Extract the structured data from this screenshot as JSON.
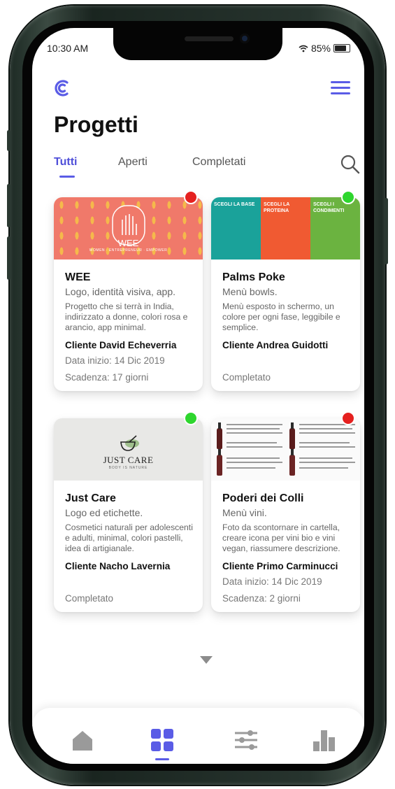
{
  "status_bar": {
    "time": "10:30 AM",
    "battery": "85%"
  },
  "header": {
    "title": "Progetti"
  },
  "tabs": [
    {
      "label": "Tutti",
      "active": true
    },
    {
      "label": "Aperti",
      "active": false
    },
    {
      "label": "Completati",
      "active": false
    }
  ],
  "projects": [
    {
      "name": "WEE",
      "subtitle": "Logo, identità visiva, app.",
      "description": "Progetto che si terrà in India, indirizzato a donne, colori rosa e arancio, app minimal.",
      "client": "Cliente David Echeverria",
      "start": "Data inizio: 14 Dic 2019",
      "deadline": "Scadenza: 17 giorni",
      "status_color": "#e5201f",
      "image_text": "WEE",
      "image_sub": "WOMEN · ENTREPRENEUR · EMPOWER"
    },
    {
      "name": "Palms Poke",
      "subtitle": "Menù bowls.",
      "description": "Menù esposto in schermo, un colore per ogni fase, leggibile e semplice.",
      "client": "Cliente Andrea Guidotti",
      "status_text": "Completato",
      "status_color": "#2ed62e",
      "image_cols": [
        "SCEGLI LA BASE",
        "SCEGLI LA PROTEINA",
        "SCEGLI I CONDIMENTI"
      ]
    },
    {
      "name": "Just Care",
      "subtitle": "Logo ed etichette.",
      "description": "Cosmetici naturali per adolescenti e adulti, minimal, colori pastelli, idea di artigianale.",
      "client": "Cliente Nacho Lavernia",
      "status_text": "Completato",
      "status_color": "#2ed62e",
      "image_text": "JUST CARE",
      "image_sub": "BODY IS NATURE"
    },
    {
      "name": "Poderi dei Colli",
      "subtitle": "Menù vini.",
      "description": "Foto da scontornare in cartella, creare icona per vini bio e vini vegan, riassumere descrizione.",
      "client": "Cliente Primo Carminucci",
      "start": "Data inizio: 14 Dic 2019",
      "deadline": "Scadenza: 2 giorni",
      "status_color": "#e5201f"
    }
  ],
  "bottom_nav": [
    {
      "icon": "home-icon",
      "active": false
    },
    {
      "icon": "grid-icon",
      "active": true
    },
    {
      "icon": "sliders-icon",
      "active": false
    },
    {
      "icon": "bar-chart-icon",
      "active": false
    }
  ],
  "colors": {
    "accent": "#5a5ce6",
    "red_status": "#e5201f",
    "green_status": "#2ed62e"
  }
}
